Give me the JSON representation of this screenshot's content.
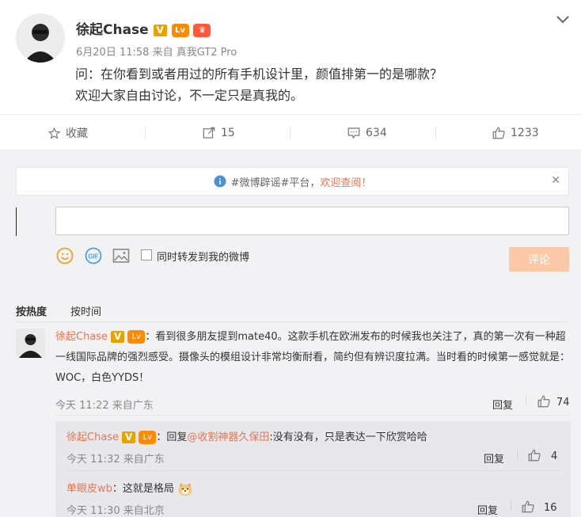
{
  "post": {
    "author": "徐起Chase",
    "v_badge": "V",
    "level_badge": "Lv",
    "time": "6月20日 11:58",
    "source_prefix": "来自",
    "source": "真我GT2 Pro",
    "line1": "问：在你看到或者用过的所有手机设计里，颜值排第一的是哪款？",
    "line2": "欢迎大家自由讨论，不一定只是真我的。"
  },
  "actions": {
    "favorite": "收藏",
    "repost_count": "15",
    "comment_count": "634",
    "like_count": "1233"
  },
  "notice": {
    "prefix": "#微博辟谣#平台，",
    "link": "欢迎查阅！"
  },
  "composer": {
    "input_value": "",
    "repost_label": "同时转发到我的微博",
    "submit_label": "评论"
  },
  "sort": {
    "hot": "按热度",
    "time": "按时间"
  },
  "comment": {
    "author": "徐起Chase",
    "text": "：看到很多朋友提到mate40。这款手机在欧洲发布的时候我也关注了，真的第一次有一种超一线国际品牌的强烈感受。摄像头的模组设计非常均衡耐看，简约但有辨识度拉满。当时看的时候第一感觉就是：WOC，白色YYDS！",
    "time": "今天 11:22",
    "source": "来自广东",
    "reply_label": "回复",
    "like_count": "74"
  },
  "replies": [
    {
      "author": "徐起Chase",
      "reply_prefix": "：回复",
      "mention": "@收割神器久保田",
      "text": ":没有没有，只是表达一下欣赏哈哈",
      "time": "今天 11:32",
      "source": "来自广东",
      "reply_label": "回复",
      "like_count": "4"
    },
    {
      "author": "单眼皮wb",
      "text": "：这就是格局",
      "time": "今天 11:30",
      "source": "来自北京",
      "reply_label": "回复",
      "like_count": "16"
    }
  ],
  "colors": {
    "accent_orange": "#eb7350",
    "submit_disabled": "#fbc9a8",
    "v_badge": "#e8a300",
    "link_blue": "#eb7350"
  },
  "icons": [
    "chevron-down-icon",
    "star-icon",
    "repost-icon",
    "comment-icon",
    "like-icon",
    "info-icon",
    "close-icon",
    "emoji-icon",
    "gif-icon",
    "image-icon",
    "doge-emoji-icon"
  ]
}
